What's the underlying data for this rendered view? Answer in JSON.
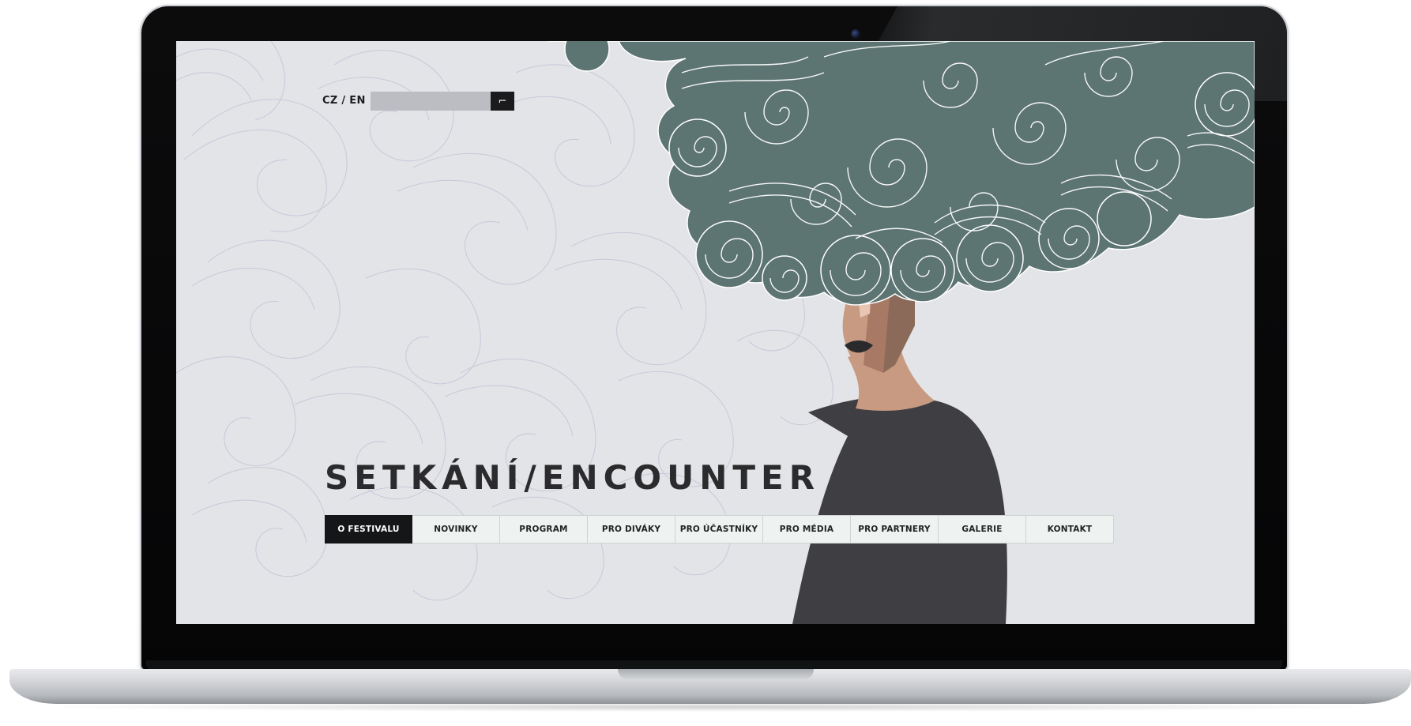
{
  "site": {
    "language_switch": "CZ / EN",
    "search": {
      "placeholder": "",
      "value": "",
      "button_glyph": "⌐"
    },
    "title": "SETKÁNÍ/ENCOUNTER",
    "nav": [
      {
        "label": "O FESTIVALU",
        "active": true
      },
      {
        "label": "NOVINKY",
        "active": false
      },
      {
        "label": "PROGRAM",
        "active": false
      },
      {
        "label": "PRO DIVÁKY",
        "active": false
      },
      {
        "label": "PRO ÚČASTNÍKY",
        "active": false
      },
      {
        "label": "PRO MÉDIA",
        "active": false
      },
      {
        "label": "PRO PARTNERY",
        "active": false
      },
      {
        "label": "GALERIE",
        "active": false
      },
      {
        "label": "KONTAKT",
        "active": false
      }
    ]
  },
  "colors": {
    "screen_background": "#e3e4e7",
    "hair": "#5c7472",
    "hair_lines": "#ffffff",
    "skin": "#c89a82",
    "skin_shadow": "#8c6a5a",
    "shirt": "#3f3f43",
    "lips": "#2a2a2d",
    "nav_active_bg": "#151618",
    "nav_bg": "#eef2f0",
    "background_swirl_lines": "#bfc3d6"
  },
  "illustration": {
    "subject": "woman-with-swirling-hair",
    "icon": "hero-illustration"
  }
}
